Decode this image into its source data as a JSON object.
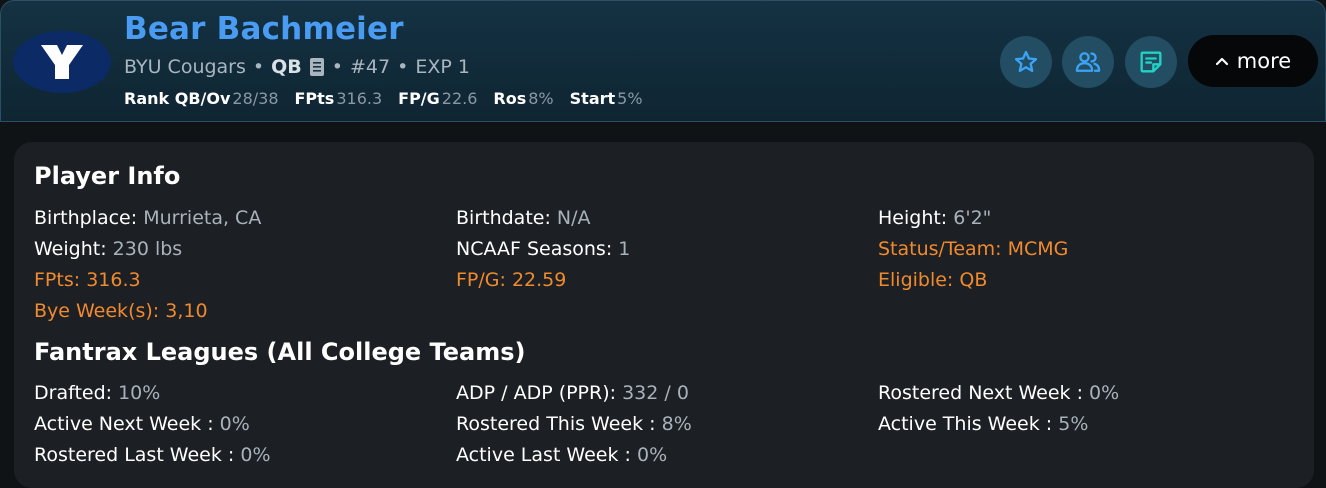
{
  "header": {
    "name": "Bear Bachmeier",
    "team": "BYU Cougars",
    "position": "QB",
    "number": "#47",
    "experience": "EXP 1",
    "separator": "•",
    "stats": [
      {
        "label": "Rank QB/Ov",
        "value": "28/38"
      },
      {
        "label": "FPts",
        "value": "316.3"
      },
      {
        "label": "FP/G",
        "value": "22.6"
      },
      {
        "label": "Ros",
        "value": "8%"
      },
      {
        "label": "Start",
        "value": "5%"
      }
    ],
    "more_label": "more",
    "logo_letter": "Y"
  },
  "icons": {
    "logo": "byu-logo-icon",
    "notes": "document-icon",
    "watch": "star-icon",
    "compare": "users-icon",
    "note": "sticky-note-icon",
    "expand": "chevron-up-icon"
  },
  "colors": {
    "name": "#4a9cf3",
    "accent": "#f08a2e",
    "icon_teal": "#22d3c5",
    "icon_blue": "#3ba3f5",
    "header_bg": "#143243",
    "card_bg": "#1c1f23"
  },
  "player_info": {
    "title": "Player Info",
    "items": [
      {
        "label": "Birthplace:",
        "value": "Murrieta, CA"
      },
      {
        "label": "Birthdate:",
        "value": "N/A"
      },
      {
        "label": "Height:",
        "value": "6'2\""
      },
      {
        "label": "Weight:",
        "value": "230 lbs"
      },
      {
        "label": "NCAAF Seasons:",
        "value": "1"
      },
      {
        "label": "Status/Team:",
        "value": "MCMG"
      },
      {
        "label": "FPts:",
        "value": "316.3"
      },
      {
        "label": "FP/G:",
        "value": "22.59"
      },
      {
        "label": "Eligible:",
        "value": "QB"
      },
      {
        "label": "Bye Week(s):",
        "value": "3,10"
      }
    ]
  },
  "leagues": {
    "title": "Fantrax Leagues (All College Teams)",
    "items": [
      {
        "label": "Drafted:",
        "value": "10%"
      },
      {
        "label": "ADP / ADP (PPR):",
        "value": "332 / 0"
      },
      {
        "label": "Rostered Next Week :",
        "value": "0%"
      },
      {
        "label": "Active Next Week :",
        "value": "0%"
      },
      {
        "label": "Rostered This Week :",
        "value": "8%"
      },
      {
        "label": "Active This Week :",
        "value": "5%"
      },
      {
        "label": "Rostered Last Week :",
        "value": "0%"
      },
      {
        "label": "Active Last Week :",
        "value": "0%"
      }
    ]
  }
}
